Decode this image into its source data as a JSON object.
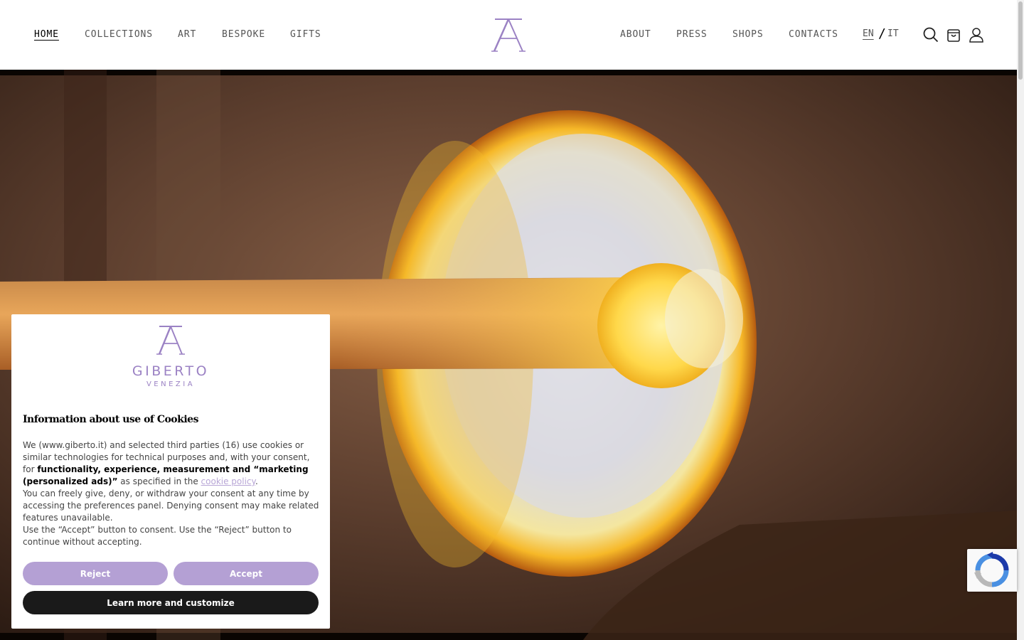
{
  "nav_left": [
    {
      "label": "HOME",
      "active": true
    },
    {
      "label": "COLLECTIONS",
      "active": false
    },
    {
      "label": "ART",
      "active": false
    },
    {
      "label": "BESPOKE",
      "active": false
    },
    {
      "label": "GIFTS",
      "active": false
    }
  ],
  "nav_right": [
    {
      "label": "ABOUT"
    },
    {
      "label": "PRESS"
    },
    {
      "label": "SHOPS"
    },
    {
      "label": "CONTACTS"
    }
  ],
  "language": {
    "current": "EN",
    "separator": "/",
    "other": "IT"
  },
  "header_icons": [
    "search-icon",
    "cart-icon",
    "user-icon"
  ],
  "cookie_banner": {
    "brand_name": "GIBERTO",
    "brand_sub": "VENEZIA",
    "title": "Information about use of Cookies",
    "p1_a": "We (www.giberto.it) and selected third parties (16) use cookies or similar technologies for technical purposes and, with your consent, for ",
    "p1_bold": "functionality, experience, measurement and “marketing (personalized ads)”",
    "p1_b": " as specified in the ",
    "p1_link": "cookie policy",
    "p1_end": ".",
    "p2": "You can freely give, deny, or withdraw your consent at any time by accessing the preferences panel. Denying consent may make related features unavailable.",
    "p3": "Use the “Accept” button to consent. Use the “Reject” button to continue without accepting.",
    "reject_label": "Reject",
    "accept_label": "Accept",
    "learn_label": "Learn more and customize"
  },
  "colors": {
    "brand_purple": "#9b82c4",
    "button_purple": "#b4a0d4",
    "button_dark": "#1a1a1a"
  }
}
